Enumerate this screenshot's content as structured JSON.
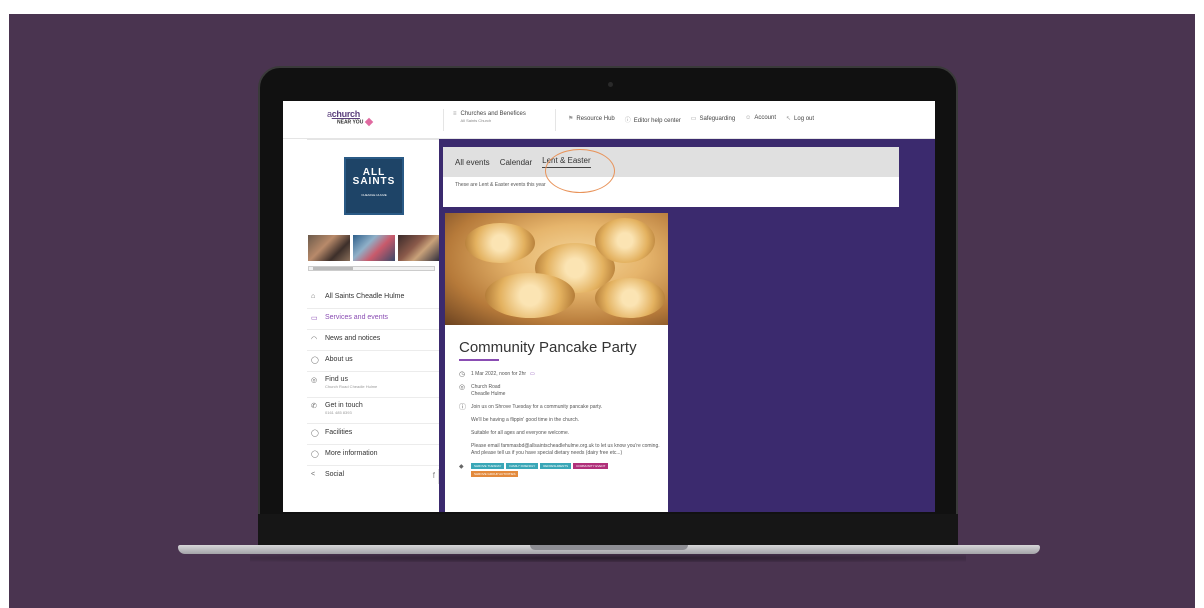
{
  "topbar": {
    "logo_prefix": "a",
    "logo_word": "church",
    "logo_sub": "NEAR YOU",
    "churches_label": "Churches and Benefices",
    "churches_sub": "All Saints Church",
    "links": [
      {
        "label": "Resource Hub",
        "icon": "flag-icon"
      },
      {
        "label": "Editor help center",
        "icon": "info-icon"
      },
      {
        "label": "Safeguarding",
        "icon": "shield-icon"
      },
      {
        "label": "Account",
        "icon": "user-icon"
      },
      {
        "label": "Log out",
        "icon": "logout-icon"
      }
    ]
  },
  "sidebar": {
    "brand_line1": "ALL",
    "brand_line2": "SAINTS",
    "brand_line3": "CHEADLE HULME",
    "items": [
      {
        "label": "All Saints Cheadle Hulme",
        "sub": "",
        "icon": "home-icon",
        "glyph": "⌂"
      },
      {
        "label": "Services and events",
        "sub": "",
        "icon": "calendar-icon",
        "glyph": "▭",
        "active": true
      },
      {
        "label": "News and notices",
        "sub": "",
        "icon": "megaphone-icon",
        "glyph": "◠"
      },
      {
        "label": "About us",
        "sub": "",
        "icon": "info-icon",
        "glyph": "◯"
      },
      {
        "label": "Find us",
        "sub": "Church Road Cheadle Hulme",
        "icon": "location-icon",
        "glyph": "◎"
      },
      {
        "label": "Get in touch",
        "sub": "0161 485 8393",
        "icon": "phone-icon",
        "glyph": "✆"
      },
      {
        "label": "Facilities",
        "sub": "",
        "icon": "facilities-icon",
        "glyph": "◯"
      },
      {
        "label": "More information",
        "sub": "",
        "icon": "question-icon",
        "glyph": "◯"
      },
      {
        "label": "Social",
        "sub": "",
        "icon": "share-icon",
        "glyph": "<"
      }
    ],
    "social_fb": "f"
  },
  "main": {
    "tabs": [
      "All events",
      "Calendar",
      "Lent & Easter"
    ],
    "active_tab": "Lent & Easter",
    "tab_desc": "These are Lent & Easter events this year",
    "card": {
      "title": "Community Pancake Party",
      "date": "1 Mar 2022, noon for 2hr",
      "location_line1": "Church Road",
      "location_line2": "Cheadle Hulme",
      "desc1": "Join us on Shrove Tuesday for a community pancake party.",
      "desc2": "We'll be having a flippin' good time in the church.",
      "desc3": "Suitable for all ages and everyone welcome.",
      "desc4": "Please email fammasbd@allsaintscheadlehulme.org.uk to let us know you're coming. And please tell us if you have special dietary needs (dairy free etc...)",
      "tags": [
        {
          "label": "SHROVE TUESDAY",
          "color": "#3aa7b7"
        },
        {
          "label": "FAMILY FRIENDLY",
          "color": "#3aa7b7"
        },
        {
          "label": "REFRESHMENTS",
          "color": "#3aa7b7"
        },
        {
          "label": "COMMUNITY EVENT",
          "color": "#b0307a"
        },
        {
          "label": "SHROVE GROUP ACTIVITIES",
          "color": "#e38a3c"
        }
      ]
    }
  },
  "colors": {
    "background": "#4a3450",
    "main_bg": "#3b2a6e",
    "accent": "#8a4db3",
    "highlight_ring": "#e8935a"
  }
}
